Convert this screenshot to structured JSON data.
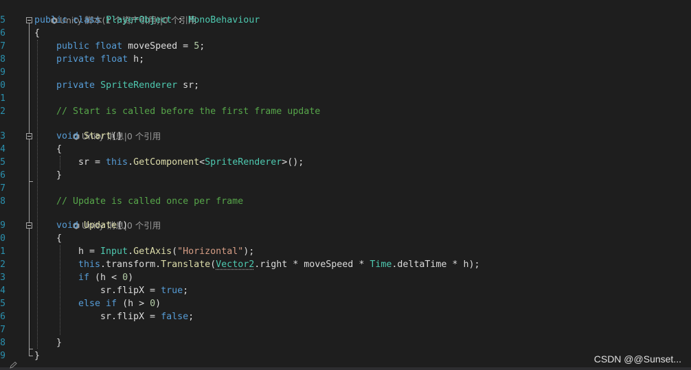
{
  "codelens": {
    "class_line": "Unity 脚本(1 个资产引用)|0 个引用",
    "start_line": "Unity 消息|0 个引用",
    "update_line": "Unity 消息|0 个引用"
  },
  "line_numbers": [
    "5",
    "6",
    "7",
    "8",
    "9",
    "0",
    "1",
    "2",
    "3",
    "4",
    "5",
    "6",
    "7",
    "8",
    "9",
    "0",
    "1",
    "2",
    "3",
    "4",
    "5",
    "6",
    "7",
    "8",
    "9"
  ],
  "code": {
    "l1": [
      "public",
      "class",
      "PlayerObject",
      ":",
      "MonoBehaviour"
    ],
    "l2": "{",
    "l3": [
      "public",
      "float",
      "moveSpeed = ",
      "5",
      ";"
    ],
    "l4": [
      "private",
      "float",
      "h;"
    ],
    "l6": [
      "private",
      "SpriteRenderer",
      "sr;"
    ],
    "l8": "// Start is called before the first frame update",
    "l9": [
      "void",
      "Start",
      "()"
    ],
    "l10": "{",
    "l11": [
      "sr = ",
      "this",
      ".",
      "GetComponent",
      "<",
      "SpriteRenderer",
      ">();"
    ],
    "l12": "}",
    "l14": "// Update is called once per frame",
    "l15": [
      "void",
      "Update",
      "()"
    ],
    "l16": "{",
    "l17": [
      "h = ",
      "Input",
      ".",
      "GetAxis",
      "(",
      "\"Horizontal\"",
      ");"
    ],
    "l18": [
      "this",
      ".transform.",
      "Translate",
      "(",
      "Vector2",
      ".right * moveSpeed * ",
      "Time",
      ".deltaTime * h);"
    ],
    "l19": [
      "if",
      " (h < ",
      "0",
      ")"
    ],
    "l20": [
      "sr.flipX = ",
      "true",
      ";"
    ],
    "l21": [
      "else",
      " ",
      "if",
      " (h > ",
      "0",
      ")"
    ],
    "l22": [
      "sr.flipX = ",
      "false",
      ";"
    ],
    "l24": "}",
    "l25": "}"
  },
  "watermark": "CSDN @@Sunset...",
  "colors": {
    "background": "#1e1e1e",
    "keyword": "#569cd6",
    "type": "#4ec9b0",
    "method": "#dcdcaa",
    "string": "#d69d85",
    "comment": "#57a64a",
    "line_number": "#2b91af"
  }
}
